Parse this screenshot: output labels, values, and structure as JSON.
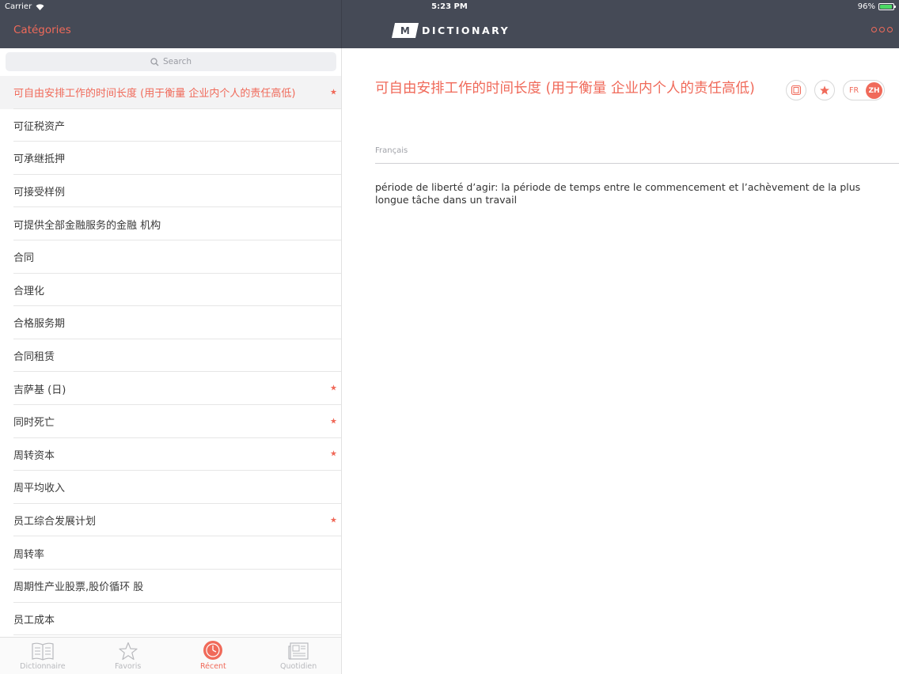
{
  "status": {
    "carrier": "Carrier",
    "time": "5:23 PM",
    "battery": "96%"
  },
  "header": {
    "categories_label": "Catégories",
    "logo_mark": "M",
    "logo_word": "DICTIONARY"
  },
  "search": {
    "placeholder": "Search"
  },
  "list": [
    {
      "label": "可自由安排工作的时间长度 (用于衡量 企业内个人的责任高低)",
      "starred": true,
      "selected": true
    },
    {
      "label": "可征税资产",
      "starred": false
    },
    {
      "label": "可承继抵押",
      "starred": false
    },
    {
      "label": "可接受样例",
      "starred": false
    },
    {
      "label": "可提供全部金融服务的金融 机构",
      "starred": false
    },
    {
      "label": "合同",
      "starred": false
    },
    {
      "label": "合理化",
      "starred": false
    },
    {
      "label": "合格服务期",
      "starred": false
    },
    {
      "label": "合同租赁",
      "starred": false
    },
    {
      "label": "吉萨基 (日)",
      "starred": true
    },
    {
      "label": "同时死亡",
      "starred": true
    },
    {
      "label": "周转资本",
      "starred": true
    },
    {
      "label": "周平均收入",
      "starred": false
    },
    {
      "label": "员工综合发展计划",
      "starred": true
    },
    {
      "label": "周转率",
      "starred": false
    },
    {
      "label": "周期性产业股票,股价循环 股",
      "starred": false
    },
    {
      "label": "员工成本",
      "starred": false
    }
  ],
  "tabs": [
    {
      "label": "Dictionnaire",
      "icon": "book-icon",
      "active": false
    },
    {
      "label": "Favoris",
      "icon": "star-icon",
      "active": false
    },
    {
      "label": "Récent",
      "icon": "clock-icon",
      "active": true
    },
    {
      "label": "Quotidien",
      "icon": "newspaper-icon",
      "active": false
    }
  ],
  "entry": {
    "title": "可自由安排工作的时间长度 (用于衡量 企业内个人的责任高低)",
    "language": "Français",
    "definition": "période de liberté d’agir: la période de temps entre le commencement et l’achèvement de la plus longue tâche dans un travail",
    "toggle_left": "FR",
    "toggle_right": "ZH"
  },
  "colors": {
    "accent": "#f06a5a",
    "bar": "#454a56"
  }
}
